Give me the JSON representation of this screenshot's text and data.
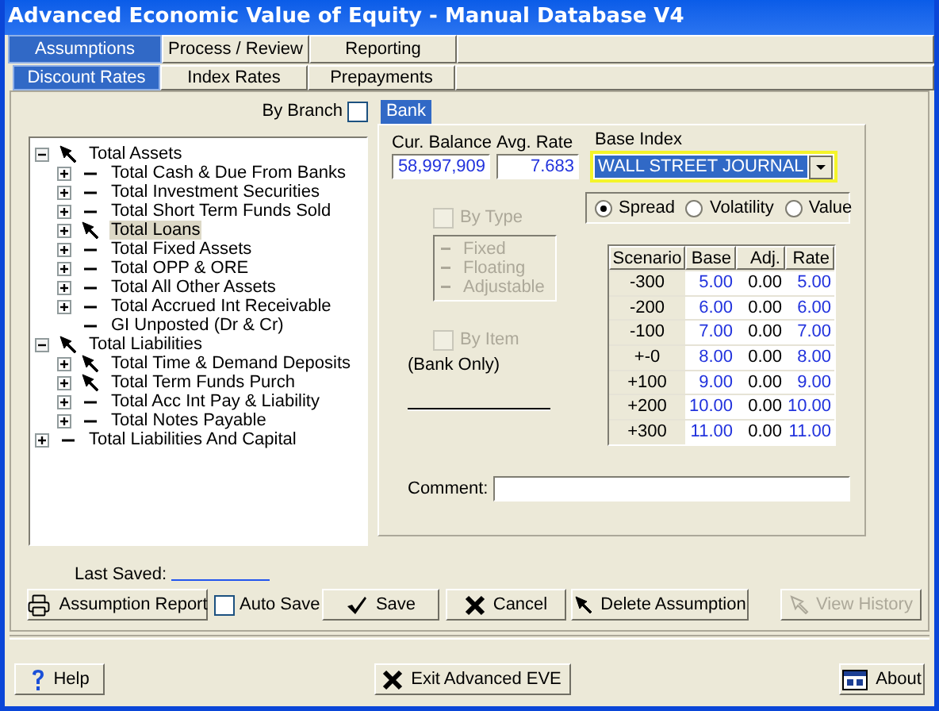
{
  "window": {
    "title": "Advanced Economic Value of Equity - Manual Database V4"
  },
  "tabs": [
    {
      "label": "Assumptions",
      "selected": true
    },
    {
      "label": "Process / Review",
      "selected": false
    },
    {
      "label": "Reporting",
      "selected": false
    }
  ],
  "subtabs": [
    {
      "label": "Discount Rates",
      "selected": true
    },
    {
      "label": "Index Rates",
      "selected": false
    },
    {
      "label": "Prepayments",
      "selected": false
    }
  ],
  "by_branch": {
    "label": "By Branch",
    "checked": false
  },
  "tree": [
    {
      "label": "Total Assets",
      "kind": "arrow",
      "expandable": true,
      "expanded": true,
      "selected": false,
      "children": [
        {
          "label": "Total Cash & Due From Banks",
          "kind": "dash",
          "expandable": true,
          "expanded": false,
          "selected": false
        },
        {
          "label": "Total Investment Securities",
          "kind": "dash",
          "expandable": true,
          "expanded": false,
          "selected": false
        },
        {
          "label": "Total Short Term Funds Sold",
          "kind": "dash",
          "expandable": true,
          "expanded": false,
          "selected": false
        },
        {
          "label": "Total Loans",
          "kind": "arrow",
          "expandable": true,
          "expanded": false,
          "selected": true
        },
        {
          "label": "Total Fixed Assets",
          "kind": "dash",
          "expandable": true,
          "expanded": false,
          "selected": false
        },
        {
          "label": "Total OPP & ORE",
          "kind": "dash",
          "expandable": true,
          "expanded": false,
          "selected": false
        },
        {
          "label": "Total All Other Assets",
          "kind": "dash",
          "expandable": true,
          "expanded": false,
          "selected": false
        },
        {
          "label": "Total Accrued Int Receivable",
          "kind": "dash",
          "expandable": true,
          "expanded": false,
          "selected": false
        },
        {
          "label": "GI Unposted (Dr & Cr)",
          "kind": "dash",
          "expandable": false,
          "selected": false
        }
      ]
    },
    {
      "label": "Total Liabilities",
      "kind": "arrow",
      "expandable": true,
      "expanded": true,
      "selected": false,
      "children": [
        {
          "label": "Total Time & Demand Deposits",
          "kind": "arrow",
          "expandable": true,
          "expanded": false,
          "selected": false
        },
        {
          "label": "Total  Term Funds Purch",
          "kind": "arrow",
          "expandable": true,
          "expanded": false,
          "selected": false
        },
        {
          "label": "Total Acc Int Pay & Liability",
          "kind": "dash",
          "expandable": true,
          "expanded": false,
          "selected": false
        },
        {
          "label": "Total Notes Payable",
          "kind": "dash",
          "expandable": true,
          "expanded": false,
          "selected": false
        }
      ]
    },
    {
      "label": "Total Liabilities And Capital",
      "kind": "dash",
      "expandable": true,
      "expanded": false,
      "selected": false
    }
  ],
  "panel": {
    "tab": "Bank",
    "cur_balance": {
      "label": "Cur. Balance",
      "value": "58,997,909"
    },
    "avg_rate": {
      "label": "Avg. Rate",
      "value": "7.683"
    },
    "base_index": {
      "label": "Base Index",
      "value": "WALL STREET JOURNAL"
    },
    "by_type": {
      "label": "By Type",
      "checked": false,
      "disabled": true
    },
    "type_list": {
      "disabled": true,
      "items": [
        "Fixed",
        "Floating",
        "Adjustable"
      ]
    },
    "by_item": {
      "label": "By Item",
      "checked": false,
      "disabled": true
    },
    "by_item_note": "(Bank Only)",
    "modes": [
      {
        "label": "Spread",
        "selected": true
      },
      {
        "label": "Volatility",
        "selected": false
      },
      {
        "label": "Value",
        "selected": false
      }
    ],
    "table": {
      "columns": [
        "Scenario",
        "Base",
        "Adj.",
        "Rate"
      ],
      "rows": [
        [
          "-300",
          "5.00",
          "0.00",
          "5.00"
        ],
        [
          "-200",
          "6.00",
          "0.00",
          "6.00"
        ],
        [
          "-100",
          "7.00",
          "0.00",
          "7.00"
        ],
        [
          "+-0",
          "8.00",
          "0.00",
          "8.00"
        ],
        [
          "+100",
          "9.00",
          "0.00",
          "9.00"
        ],
        [
          "+200",
          "10.00",
          "0.00",
          "10.00"
        ],
        [
          "+300",
          "11.00",
          "0.00",
          "11.00"
        ]
      ]
    },
    "comment": {
      "label": "Comment:"
    }
  },
  "last_saved": {
    "label": "Last Saved:"
  },
  "report_button": {
    "label": "Assumption Report",
    "kind": "printer"
  },
  "auto_save": {
    "label": "Auto Save",
    "checked": false
  },
  "buttons": [
    {
      "label": "Save",
      "kind": "check",
      "disabled": false
    },
    {
      "label": "Cancel",
      "kind": "cross",
      "disabled": false
    },
    {
      "label": "Delete Assumption",
      "kind": "pointer",
      "disabled": false
    },
    {
      "label": "View History",
      "kind": "pointer",
      "disabled": true
    }
  ],
  "footer": [
    {
      "label": "Help",
      "kind": "question"
    },
    {
      "label": "Exit Advanced EVE",
      "kind": "cross"
    },
    {
      "label": "About",
      "kind": "window"
    }
  ]
}
